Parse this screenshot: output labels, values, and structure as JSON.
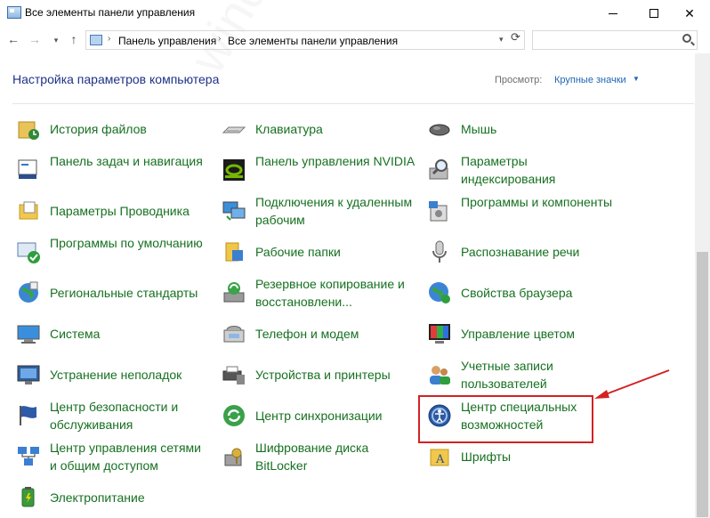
{
  "window": {
    "title": "Все элементы панели управления",
    "minimize": "—",
    "maximize": "□",
    "close": "✕"
  },
  "address": {
    "breadcrumb": [
      "Панель управления",
      "Все элементы панели управления"
    ],
    "search_placeholder": ""
  },
  "header": {
    "title": "Настройка параметров компьютера",
    "view_label": "Просмотр:",
    "view_value": "Крупные значки"
  },
  "watermark": "windowstips.ru",
  "items": [
    {
      "label": "История файлов",
      "icon": "file-history-icon"
    },
    {
      "label": "Клавиатура",
      "icon": "keyboard-icon"
    },
    {
      "label": "Мышь",
      "icon": "mouse-icon"
    },
    {
      "label": "Панель задач и навигация",
      "icon": "taskbar-icon"
    },
    {
      "label": "Панель управления NVIDIA",
      "icon": "nvidia-icon"
    },
    {
      "label": "Параметры индексирования",
      "icon": "indexing-icon"
    },
    {
      "label": "Параметры Проводника",
      "icon": "explorer-options-icon"
    },
    {
      "label": "Подключения к удаленным рабочим",
      "icon": "remote-desktop-icon"
    },
    {
      "label": "Программы и компоненты",
      "icon": "programs-icon"
    },
    {
      "label": "Программы по умолчанию",
      "icon": "default-programs-icon"
    },
    {
      "label": "Рабочие папки",
      "icon": "work-folders-icon"
    },
    {
      "label": "Распознавание речи",
      "icon": "microphone-icon"
    },
    {
      "label": "Региональные стандарты",
      "icon": "region-icon"
    },
    {
      "label": "Резервное копирование и восстановлени...",
      "icon": "backup-icon"
    },
    {
      "label": "Свойства браузера",
      "icon": "browser-properties-icon"
    },
    {
      "label": "Система",
      "icon": "system-icon"
    },
    {
      "label": "Телефон и модем",
      "icon": "phone-modem-icon"
    },
    {
      "label": "Управление цветом",
      "icon": "color-management-icon"
    },
    {
      "label": "Устранение неполадок",
      "icon": "troubleshooting-icon"
    },
    {
      "label": "Устройства и принтеры",
      "icon": "devices-printers-icon"
    },
    {
      "label": "Учетные записи пользователей",
      "icon": "user-accounts-icon"
    },
    {
      "label": "Центр безопасности и обслуживания",
      "icon": "security-flag-icon"
    },
    {
      "label": "Центр синхронизации",
      "icon": "sync-center-icon"
    },
    {
      "label": "Центр специальных возможностей",
      "icon": "accessibility-icon"
    },
    {
      "label": "Центр управления сетями и общим доступом",
      "icon": "network-center-icon"
    },
    {
      "label": "Шифрование диска BitLocker",
      "icon": "bitlocker-icon"
    },
    {
      "label": "Шрифты",
      "icon": "fonts-icon"
    },
    {
      "label": "Электропитание",
      "icon": "power-options-icon"
    }
  ],
  "annotation": {
    "highlight_color": "#d22222",
    "highlighted_item": "Центр специальных возможностей"
  }
}
